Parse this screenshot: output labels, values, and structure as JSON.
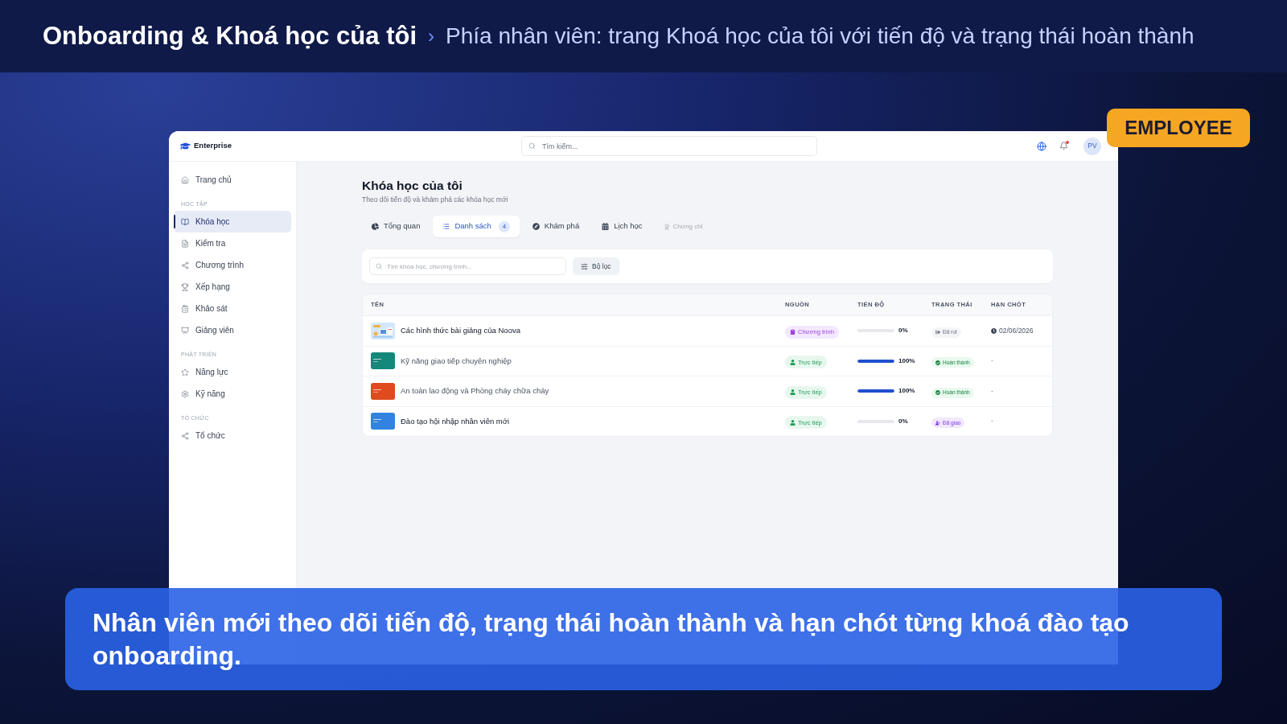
{
  "header": {
    "title": "Onboarding & Khoá học của tôi",
    "separator": "›",
    "subtitle": "Phía nhân viên: trang Khoá học của tôi với tiến độ và trạng thái hoàn thành"
  },
  "role_badge": "EMPLOYEE",
  "app": {
    "brand": "Enterprise",
    "search": {
      "placeholder": "Tìm kiếm..."
    },
    "notifications": {
      "unread": true
    },
    "avatar": "PV",
    "sidebar": {
      "items": [
        {
          "label": "Trang chủ",
          "selected": false
        }
      ],
      "sections": [
        {
          "title": "HỌC TẬP",
          "items": [
            {
              "label": "Khóa học",
              "selected": true
            },
            {
              "label": "Kiểm tra",
              "selected": false
            },
            {
              "label": "Chương trình",
              "selected": false
            },
            {
              "label": "Xếp hạng",
              "selected": false
            },
            {
              "label": "Khảo sát",
              "selected": false
            },
            {
              "label": "Giảng viên",
              "selected": false
            }
          ]
        },
        {
          "title": "PHÁT TRIỂN",
          "items": [
            {
              "label": "Năng lực",
              "selected": false
            },
            {
              "label": "Kỹ năng",
              "selected": false
            }
          ]
        },
        {
          "title": "TỔ CHỨC",
          "items": [
            {
              "label": "Tổ chức",
              "selected": false
            }
          ]
        }
      ]
    },
    "page": {
      "title": "Khóa học của tôi",
      "subtitle": "Theo dõi tiến độ và khám phá các khóa học mới",
      "tabs": [
        {
          "label": "Tổng quan",
          "selected": false,
          "disabled": false
        },
        {
          "label": "Danh sách",
          "selected": true,
          "disabled": false,
          "count": "4"
        },
        {
          "label": "Khám phá",
          "selected": false,
          "disabled": false
        },
        {
          "label": "Lịch học",
          "selected": false,
          "disabled": false
        },
        {
          "label": "Chứng chỉ",
          "selected": false,
          "disabled": true
        }
      ],
      "filter": {
        "search": {
          "placeholder": "Tìm khóa học, chương trình..."
        },
        "button": "Bộ lọc"
      },
      "table": {
        "columns": [
          "TÊN",
          "NGUỒN",
          "TIẾN ĐỘ",
          "TRẠNG THÁI",
          "HẠN CHÓT"
        ],
        "rows": [
          {
            "name": "Các hình thức bài giảng của Noova",
            "thumbnail": {
              "kind": "illustration"
            },
            "source": {
              "kind": "program",
              "label": "Chương trình"
            },
            "progress": {
              "level": 0,
              "reading": "0%"
            },
            "status": {
              "kind": "withdrawn",
              "label": "Đã rút"
            },
            "deadline": {
              "kind": "date",
              "text": "02/06/2026"
            }
          },
          {
            "name": "Kỹ năng giao tiếp chuyên nghiệp",
            "thumbnail": {
              "kind": "cover",
              "color": "#14887a"
            },
            "source": {
              "kind": "direct",
              "label": "Trực tiếp"
            },
            "progress": {
              "level": 1,
              "reading": "100%"
            },
            "status": {
              "kind": "completed",
              "label": "Hoàn thành"
            },
            "deadline": {
              "kind": "empty",
              "text": "-"
            }
          },
          {
            "name": "An toàn lao động và Phòng cháy chữa cháy",
            "thumbnail": {
              "kind": "cover",
              "color": "#df4a1e"
            },
            "source": {
              "kind": "direct",
              "label": "Trực tiếp"
            },
            "progress": {
              "level": 1,
              "reading": "100%"
            },
            "status": {
              "kind": "completed",
              "label": "Hoàn thành"
            },
            "deadline": {
              "kind": "empty",
              "text": "-"
            }
          },
          {
            "name": "Đào tạo hội nhập nhân viên mới",
            "thumbnail": {
              "kind": "cover",
              "color": "#3283e0"
            },
            "source": {
              "kind": "direct",
              "label": "Trực tiếp"
            },
            "progress": {
              "level": 0,
              "reading": "0%"
            },
            "status": {
              "kind": "assigned",
              "label": "Đã giao"
            },
            "deadline": {
              "kind": "empty",
              "text": "-"
            }
          }
        ]
      }
    }
  },
  "caption": "Nhân viên mới theo dõi tiến độ, trạng thái hoàn thành và hạn chót từng khoá đào tạo onboarding."
}
